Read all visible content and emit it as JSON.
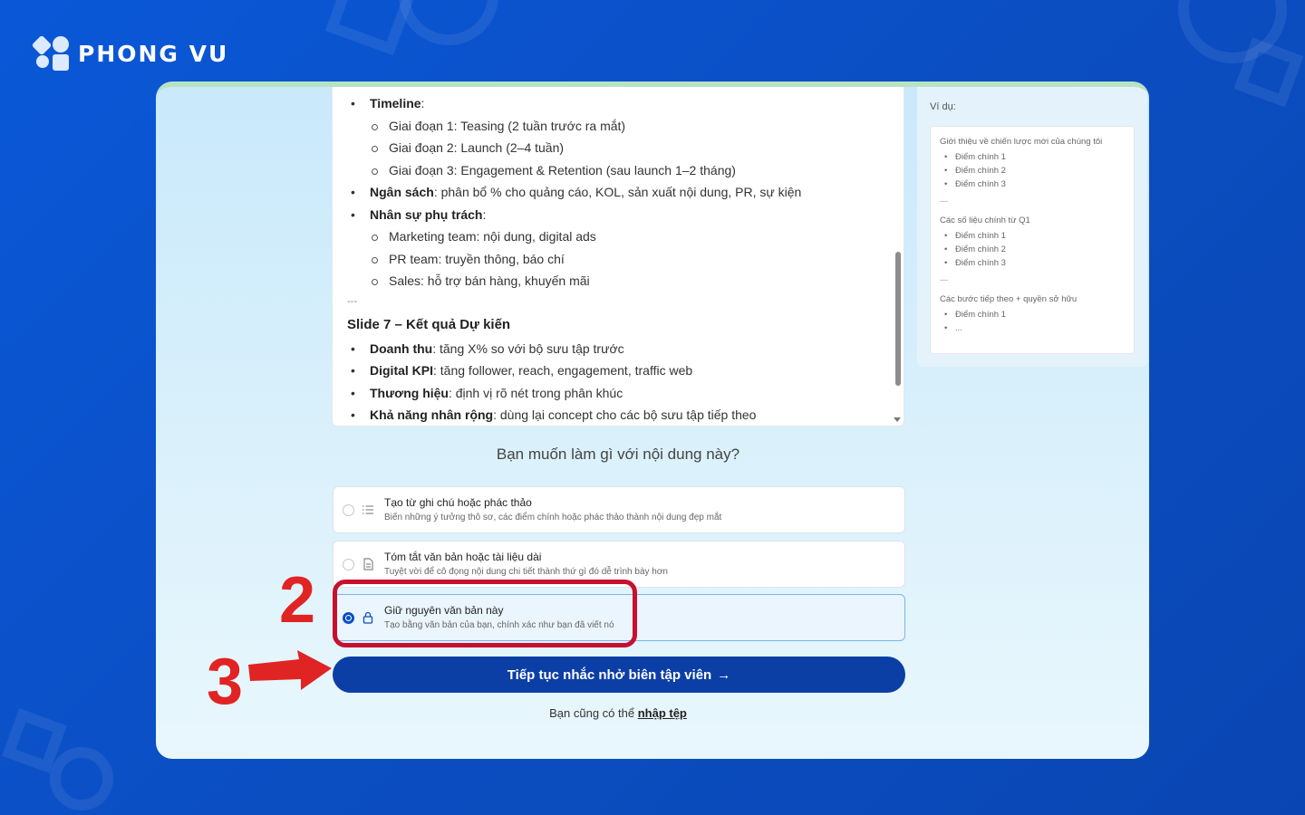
{
  "brand": {
    "name": "PHONG VU"
  },
  "editor": {
    "timeline_label": "Timeline",
    "timeline_items": [
      "Giai đoạn 1: Teasing (2 tuần trước ra mắt)",
      "Giai đoạn 2: Launch (2–4 tuần)",
      "Giai đoạn 3: Engagement & Retention (sau launch 1–2 tháng)"
    ],
    "budget_label": "Ngân sách",
    "budget_text": ": phân bổ % cho quảng cáo, KOL, sản xuất nội dung, PR, sự kiện",
    "staff_label": "Nhân sự phụ trách",
    "staff_items": [
      "Marketing team: nội dung, digital ads",
      "PR team: truyền thông, báo chí",
      "Sales: hỗ trợ bán hàng, khuyến mãi"
    ],
    "separator": "---",
    "slide7_title": "Slide 7 – Kết quả Dự kiến",
    "results": [
      {
        "label": "Doanh thu",
        "text": ": tăng X% so với bộ sưu tập trước"
      },
      {
        "label": "Digital KPI",
        "text": ": tăng follower, reach, engagement, traffic web"
      },
      {
        "label": "Thương hiệu",
        "text": ": định vị rõ nét trong phân khúc"
      },
      {
        "label": "Khả năng nhân rộng",
        "text": ": dùng lại concept cho các bộ sưu tập tiếp theo"
      }
    ]
  },
  "sidebar": {
    "example_label": "Ví dụ:",
    "groups": [
      {
        "heading": "Giới thiệu về chiến lược mới của chúng tôi",
        "items": [
          "Điểm chính 1",
          "Điểm chính 2",
          "Điểm chính 3"
        ]
      },
      {
        "heading": "Các số liệu chính từ Q1",
        "items": [
          "Điểm chính 1",
          "Điểm chính 2",
          "Điểm chính 3"
        ]
      },
      {
        "heading": "Các bước tiếp theo + quyền sở hữu",
        "items": [
          "Điểm chính 1",
          "..."
        ]
      }
    ],
    "separator": "---"
  },
  "question": "Bạn muốn làm gì với nội dung này?",
  "options": [
    {
      "title": "Tạo từ ghi chú hoặc phác thảo",
      "desc": "Biến những ý tưởng thô sơ, các điểm chính hoặc phác thảo thành nội dung đẹp mắt",
      "icon": "list-icon",
      "selected": false
    },
    {
      "title": "Tóm tắt văn bản hoặc tài liệu dài",
      "desc": "Tuyệt vời để cô đọng nội dung chi tiết thành thứ gì đó dễ trình bày hơn",
      "icon": "document-icon",
      "selected": false
    },
    {
      "title": "Giữ nguyên văn bản này",
      "desc": "Tạo bằng văn bản của bạn, chính xác như bạn đã viết nó",
      "icon": "lock-icon",
      "selected": true
    }
  ],
  "cta": {
    "label": "Tiếp tục nhắc nhở biên tập viên",
    "arrow": "→"
  },
  "footer": {
    "text": "Bạn cũng có thể ",
    "link": "nhập tệp"
  },
  "annotations": {
    "step2": "2",
    "step3": "3",
    "highlight_color": "#c8102e",
    "arrow_color": "#e02424"
  },
  "colors": {
    "primary": "#0b3fa6",
    "background": "#0a58d8"
  }
}
